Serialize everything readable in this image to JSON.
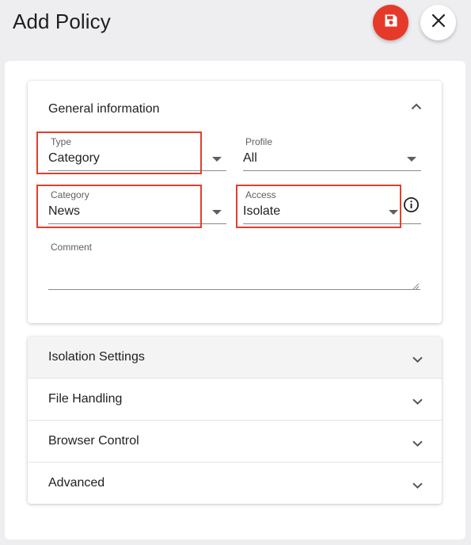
{
  "header": {
    "title": "Add Policy",
    "save_icon": "floppy-disk-icon",
    "close_icon": "close-icon",
    "save_color": "#e53a2a"
  },
  "general": {
    "title": "General information",
    "collapse_icon": "chevron-up-icon",
    "type": {
      "label": "Type",
      "value": "Category"
    },
    "profile": {
      "label": "Profile",
      "value": "All"
    },
    "category": {
      "label": "Category",
      "value": "News"
    },
    "access": {
      "label": "Access",
      "value": "Isolate",
      "info_icon": "info-icon"
    },
    "comment": {
      "label": "Comment",
      "value": ""
    }
  },
  "highlight_color": "#e0402b",
  "sections": [
    {
      "label": "Isolation Settings",
      "icon": "chevron-down-icon"
    },
    {
      "label": "File Handling",
      "icon": "chevron-down-icon"
    },
    {
      "label": "Browser Control",
      "icon": "chevron-down-icon"
    },
    {
      "label": "Advanced",
      "icon": "chevron-down-icon"
    }
  ]
}
